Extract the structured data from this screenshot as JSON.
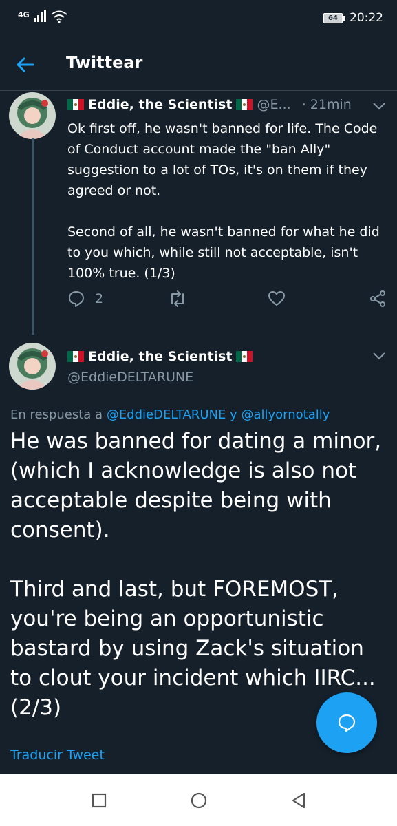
{
  "status_bar": {
    "network": "4G",
    "battery": "64",
    "time": "20:22"
  },
  "header": {
    "title": "Twittear"
  },
  "tweet1": {
    "name": "Eddie, the Scientist",
    "handle": "@E...",
    "time": "· 21min",
    "text": "Ok first off, he wasn't banned for life. The Code of Conduct account made the \"ban Ally\" suggestion to a lot of TOs, it's on them if they agreed or not.\n\nSecond of all, he wasn't banned for what he did to you which, while still not acceptable, isn't 100% true. (1/3)",
    "reply_count": "2"
  },
  "tweet2": {
    "name": "Eddie, the Scientist",
    "handle": "@EddieDELTARUNE",
    "reply_prefix": "En respuesta a ",
    "reply_user1": "@EddieDELTARUNE",
    "reply_joiner": " y ",
    "reply_user2": "@allyornotally",
    "text": "He was banned for dating a minor, (which I acknowledge is also not acceptable despite being with consent).\n\nThird and last, but FOREMOST, you're being an opportunistic bastard by using Zack's situation to clout your incident which IIRC... (2/3)",
    "translate": "Traducir Tweet"
  },
  "colors": {
    "background": "#15202b",
    "accent": "#1da1f2",
    "muted": "#8899a6",
    "divider": "#38444d"
  },
  "icons": [
    "back-arrow-icon",
    "chevron-down-icon",
    "reply-icon",
    "retweet-icon",
    "like-icon",
    "share-icon",
    "compose-reply-icon",
    "mexico-flag-icon",
    "signal-icon",
    "wifi-icon",
    "battery-icon",
    "nav-recents-icon",
    "nav-home-icon",
    "nav-back-icon"
  ]
}
